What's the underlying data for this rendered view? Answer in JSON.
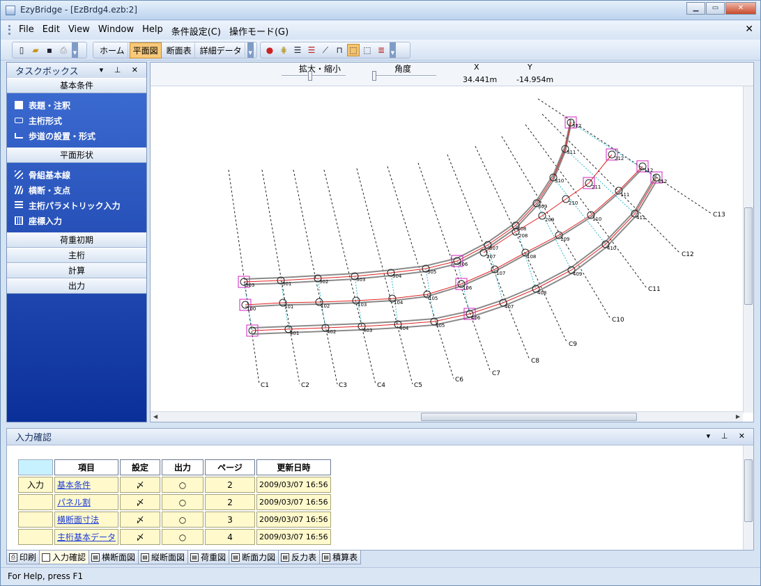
{
  "window": {
    "title": "EzyBridge - [EzBrdg4.ezb:2]"
  },
  "menu": [
    "File",
    "Edit",
    "View",
    "Window",
    "Help",
    "条件設定(C)",
    "操作モード(G)"
  ],
  "toolbar": {
    "modes": [
      "ホーム",
      "平面図",
      "断面表",
      "詳細データ"
    ],
    "active_mode": "平面図"
  },
  "taskbox": {
    "title": "タスクボックス",
    "sections": [
      {
        "label": "基本条件",
        "items": [
          {
            "label": "表題・注釈",
            "icon": "document-icon"
          },
          {
            "label": "主桁形式",
            "icon": "rectangle-icon"
          },
          {
            "label": "歩道の設置・形式",
            "icon": "sidewalk-icon"
          }
        ]
      },
      {
        "label": "平面形状",
        "items": [
          {
            "label": "骨組基本線",
            "icon": "network-icon"
          },
          {
            "label": "横断・支点",
            "icon": "hatch-icon"
          },
          {
            "label": "主桁パラメトリック入力",
            "icon": "list-icon"
          },
          {
            "label": "座標入力",
            "icon": "grid-icon"
          }
        ]
      },
      {
        "label": "荷重初期",
        "items": []
      },
      {
        "label": "主桁",
        "items": []
      },
      {
        "label": "計算",
        "items": []
      },
      {
        "label": "出力",
        "items": []
      }
    ]
  },
  "view": {
    "zoom_label": "拡大・縮小",
    "angle_label": "角度",
    "x_label": "X",
    "y_label": "Y",
    "x_value": "34.441m",
    "y_value": "-14.954m"
  },
  "plan": {
    "support_labels": [
      "C1",
      "C2",
      "C3",
      "C4",
      "C5",
      "C6",
      "C7",
      "C8",
      "C9",
      "C10",
      "C11",
      "C12",
      "C13"
    ],
    "girder_labels": {
      "g3": [
        "303",
        "301",
        "302",
        "303",
        "304",
        "305",
        "306",
        "307",
        "308",
        "309",
        "310",
        "311",
        "312"
      ],
      "g1": [
        "100",
        "101",
        "102",
        "103",
        "104",
        "105",
        "106",
        "107",
        "108",
        "109",
        "110",
        "111",
        "112"
      ],
      "g4": [
        "401",
        "402",
        "403",
        "404",
        "405",
        "406",
        "407",
        "408",
        "409",
        "410",
        "411",
        "412"
      ],
      "g2": [
        "207",
        "208",
        "209",
        "210",
        "211",
        "212"
      ]
    }
  },
  "confirm": {
    "title": "入力確認",
    "headers": [
      "項目",
      "設定",
      "出力",
      "ページ",
      "更新日時"
    ],
    "rows": [
      {
        "group": "入力",
        "item": "基本条件",
        "set": "〆",
        "out": "○",
        "page": "2",
        "date": "2009/03/07 16:56"
      },
      {
        "group": "",
        "item": "パネル割",
        "set": "〆",
        "out": "○",
        "page": "2",
        "date": "2009/03/07 16:56"
      },
      {
        "group": "",
        "item": "横断面寸法",
        "set": "〆",
        "out": "○",
        "page": "3",
        "date": "2009/03/07 16:56"
      },
      {
        "group": "",
        "item": "主桁基本データ",
        "set": "〆",
        "out": "○",
        "page": "4",
        "date": "2009/03/07 16:56"
      }
    ]
  },
  "tabs": [
    "印刷",
    "入力確認",
    "横断面図",
    "縦断面図",
    "荷重図",
    "断面力図",
    "反力表",
    "積算表"
  ],
  "active_tab": "入力確認",
  "status": "For Help, press F1"
}
